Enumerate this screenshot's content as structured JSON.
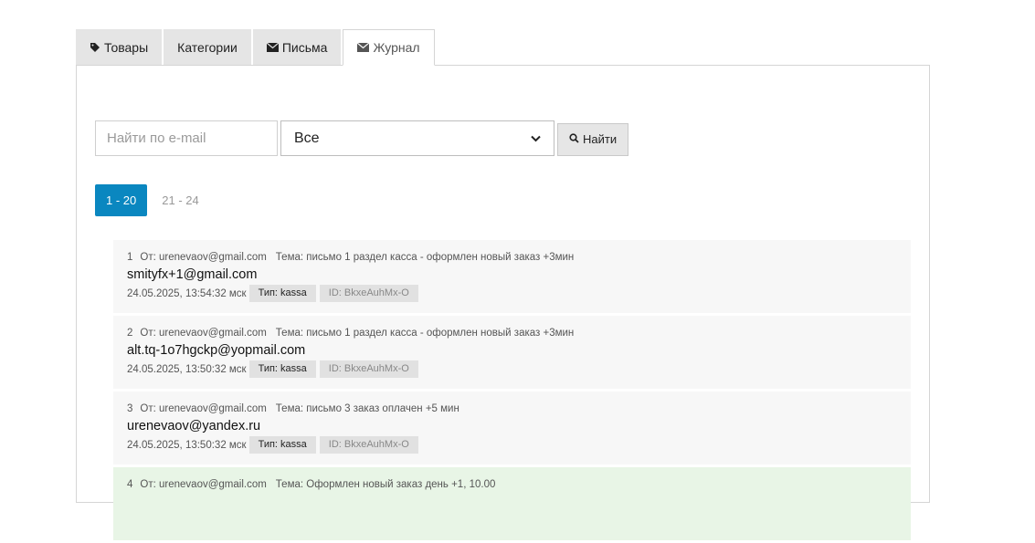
{
  "tabs": [
    {
      "label": "Товары",
      "icon": "tag-icon"
    },
    {
      "label": "Категории",
      "icon": ""
    },
    {
      "label": "Письма",
      "icon": "envelope-icon"
    },
    {
      "label": "Журнал",
      "icon": "envelope-icon",
      "active": true
    }
  ],
  "search": {
    "placeholder": "Найти по e-mail",
    "value": "",
    "filter_selected": "Все",
    "button_label": "Найти"
  },
  "pagination": [
    {
      "label": "1 - 20",
      "active": true
    },
    {
      "label": "21 - 24",
      "active": false
    }
  ],
  "log": [
    {
      "num": "1",
      "from": "От: urenevaov@gmail.com",
      "subject": "Тема: письмо 1 раздел касса - оформлен новый заказ +3мин",
      "recipient": "smityfx+1@gmail.com",
      "date": "24.05.2025, 13:54:32 мск",
      "type": "Тип: kassa",
      "id": "ID: BkxeAuhMx-O"
    },
    {
      "num": "2",
      "from": "От: urenevaov@gmail.com",
      "subject": "Тема: письмо 1 раздел касса - оформлен новый заказ +3мин",
      "recipient": "alt.tq-1o7hgckp@yopmail.com",
      "date": "24.05.2025, 13:50:32 мск",
      "type": "Тип: kassa",
      "id": "ID: BkxeAuhMx-O"
    },
    {
      "num": "3",
      "from": "От: urenevaov@gmail.com",
      "subject": "Тема: письмо 3 заказ оплачен +5 мин",
      "recipient": "urenevaov@yandex.ru",
      "date": "24.05.2025, 13:50:32 мск",
      "type": "Тип: kassa",
      "id": "ID: BkxeAuhMx-O"
    },
    {
      "num": "4",
      "from": "От: urenevaov@gmail.com",
      "subject": "Тема: Оформлен новый заказ день +1, 10.00",
      "recipient": "",
      "date": "",
      "type": "",
      "id": ""
    }
  ],
  "colors": {
    "active_page": "#0a87c0",
    "highlight_row": "#e8f5e6"
  }
}
